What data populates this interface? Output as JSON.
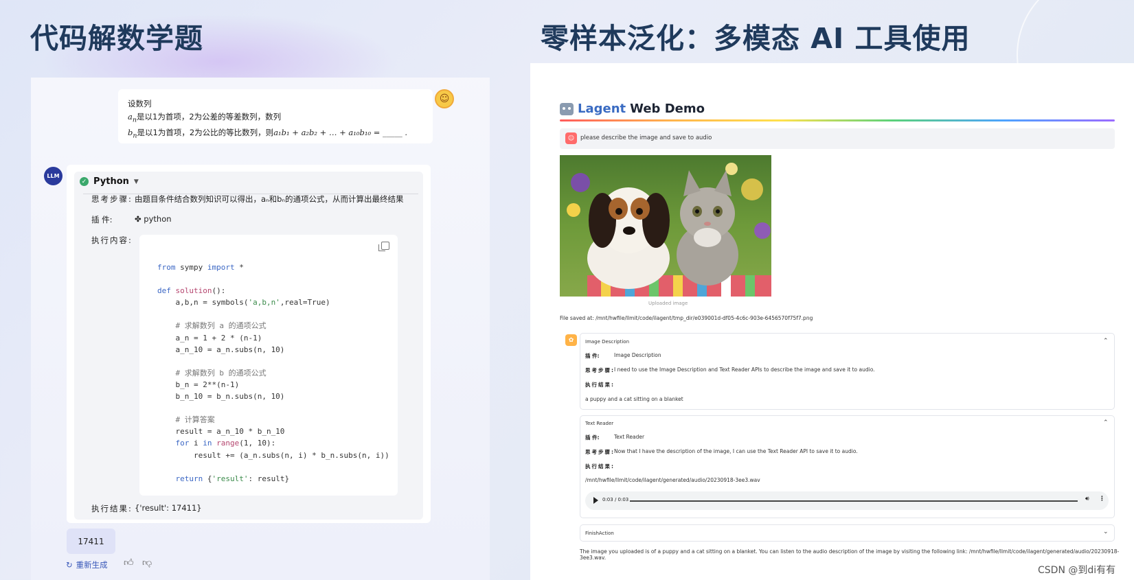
{
  "headings": {
    "left": "代码解数学题",
    "right": "零样本泛化：多模态 AI 工具使用"
  },
  "user_message": {
    "line1": "设数列",
    "line2_var": "a",
    "line2_sub": "n",
    "line2_text": "是以1为首项，2为公差的等差数列，数列",
    "line3_var": "b",
    "line3_sub": "n",
    "line3_text": "是以1为首项，2为公比的等比数列，则",
    "line3_expr": "a₁b₁ + a₂b₂ + … + a₁₀b₁₀ = _____ ."
  },
  "llm": {
    "avatar": "LLM",
    "tool_title": "Python",
    "thought_label": "思考步骤:",
    "thought_value": "由题目条件结合数列知识可以得出，aₙ和bₙ的通项公式，从而计算出最终结果",
    "plugin_label": "插    件:",
    "plugin_value": "python",
    "exec_label": "执行内容:",
    "code": [
      "from sympy import *",
      "",
      "def solution():",
      "    a,b,n = symbols('a,b,n',real=True)",
      "",
      "    # 求解数列 a 的通项公式",
      "    a_n = 1 + 2 * (n-1)",
      "    a_n_10 = a_n.subs(n, 10)",
      "",
      "    # 求解数列 b 的通项公式",
      "    b_n = 2**(n-1)",
      "    b_n_10 = b_n.subs(n, 10)",
      "",
      "    # 计算答案",
      "    result = a_n_10 * b_n_10",
      "    for i in range(1, 10):",
      "        result += (a_n.subs(n, i) * b_n.subs(n, i))",
      "",
      "    return {'result': result}"
    ],
    "result_label": "执行结果:",
    "result_value": "{'result': 17411}",
    "answer": "17411",
    "regen_label": "重新生成"
  },
  "demo": {
    "title_accent": "Lagent",
    "title_rest": "Web Demo",
    "prompt": "please describe the image and save to audio",
    "caption": "Uploaded image",
    "saved": "File saved at: /mnt/hwfile/llmit/code/ilagent/tmp_dir/e039001d-df05-4c6c-903e-6456570f75f7.png",
    "exp1": {
      "title": "Image Description",
      "plugin_label": "插    件:",
      "plugin_value": "Image Description",
      "thought_label": "思考步骤:",
      "thought_value": "I need to use the Image Description and Text Reader APIs to describe the image and save it to audio.",
      "exec_label": "执行结果:",
      "exec_value": "a puppy and a cat sitting on a blanket"
    },
    "exp2": {
      "title": "Text Reader",
      "plugin_label": "插    件:",
      "plugin_value": "Text Reader",
      "thought_label": "思考步骤:",
      "thought_value": "Now that I have the description of the image, I can use the Text Reader API to save it to audio.",
      "exec_label": "执行结果:",
      "exec_value": "/mnt/hwfile/llmit/code/ilagent/generated/audio/20230918-3ee3.wav",
      "audio_time": "0:03 / 0:03"
    },
    "exp3": {
      "title": "FinishAction"
    },
    "final": "The image you uploaded is of a puppy and a cat sitting on a blanket. You can listen to the audio description of the image by visiting the following link: /mnt/hwfile/llmit/code/ilagent/generated/audio/20230918-3ee3.wav."
  },
  "watermark": "CSDN @到di有有"
}
